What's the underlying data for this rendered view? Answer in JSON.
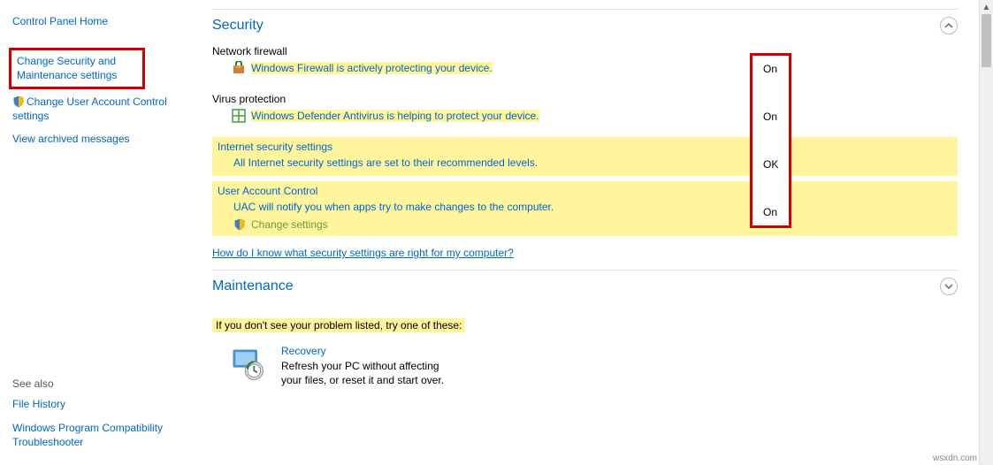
{
  "sidebar": {
    "home": "Control Panel Home",
    "change_security": "Change Security and Maintenance settings",
    "change_uac": "Change User Account Control settings",
    "archived": "View archived messages",
    "see_also_head": "See also",
    "file_history": "File History",
    "win_program": "Windows Program Compatibility Troubleshooter"
  },
  "security": {
    "title": "Security",
    "firewall": {
      "label": "Network firewall",
      "msg": "Windows Firewall is actively protecting your device.",
      "status": "On"
    },
    "virus": {
      "label": "Virus protection",
      "msg": "Windows Defender Antivirus is helping to protect your device.",
      "status": "On"
    },
    "internet": {
      "label": "Internet security settings",
      "msg": "All Internet security settings are set to their recommended levels.",
      "status": "OK"
    },
    "uac": {
      "label": "User Account Control",
      "msg": "UAC will notify you when apps try to make changes to the computer.",
      "change": "Change settings",
      "status": "On"
    },
    "help": "How do I know what security settings are right for my computer?"
  },
  "maintenance": {
    "title": "Maintenance"
  },
  "prompt": "If you don't see your problem listed, try one of these:",
  "recovery": {
    "title": "Recovery",
    "desc": "Refresh your PC without affecting your files, or reset it and start over."
  },
  "watermark": "wsxdn.com"
}
